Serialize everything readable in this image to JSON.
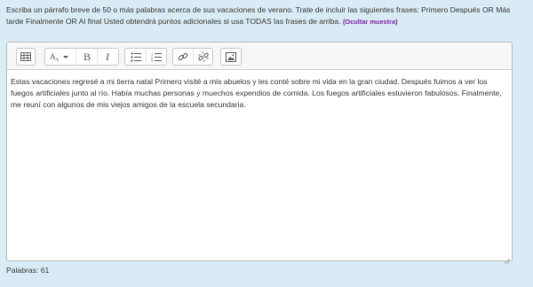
{
  "prompt": {
    "text": "Escriba un párrafo breve de 50 o más palabras acerca de sus vacaciones de verano. Trate de incluir las siguientes frases: Primero Después OR Más tarde Finalmente OR Al final Usted obtendrá puntos adicionales si usa TODAS las frases de arriba.",
    "toggle_sample": "(Ocultar muestra)"
  },
  "toolbar": {
    "buttons": [
      {
        "name": "toolbar-toggle-button",
        "icon": "toolbar-toggle-icon"
      },
      {
        "name": "font-size-button",
        "icon": "font-size-icon"
      },
      {
        "name": "bold-button",
        "icon": "bold-icon"
      },
      {
        "name": "italic-button",
        "icon": "italic-icon"
      },
      {
        "name": "bulleted-list-button",
        "icon": "bulleted-list-icon"
      },
      {
        "name": "numbered-list-button",
        "icon": "numbered-list-icon"
      },
      {
        "name": "link-button",
        "icon": "link-icon"
      },
      {
        "name": "unlink-button",
        "icon": "unlink-icon"
      },
      {
        "name": "insert-image-button",
        "icon": "image-icon"
      }
    ]
  },
  "editor": {
    "content": "Estas vacaciones regresé a mi tierra natal Primero visité a mis abuelos y les conté sobre mi vida en la gran ciudad. Después fuimos a ver los fuegos artificiales junto al río. Había muchas personas y muechos expendios de comida. Los fuegos artificiales estuvieron fabulosos. Finalmente, me reuní con algunos de mis viejos amigos de la escuela secundaria."
  },
  "footer": {
    "word_count": "Palabras: 61"
  }
}
